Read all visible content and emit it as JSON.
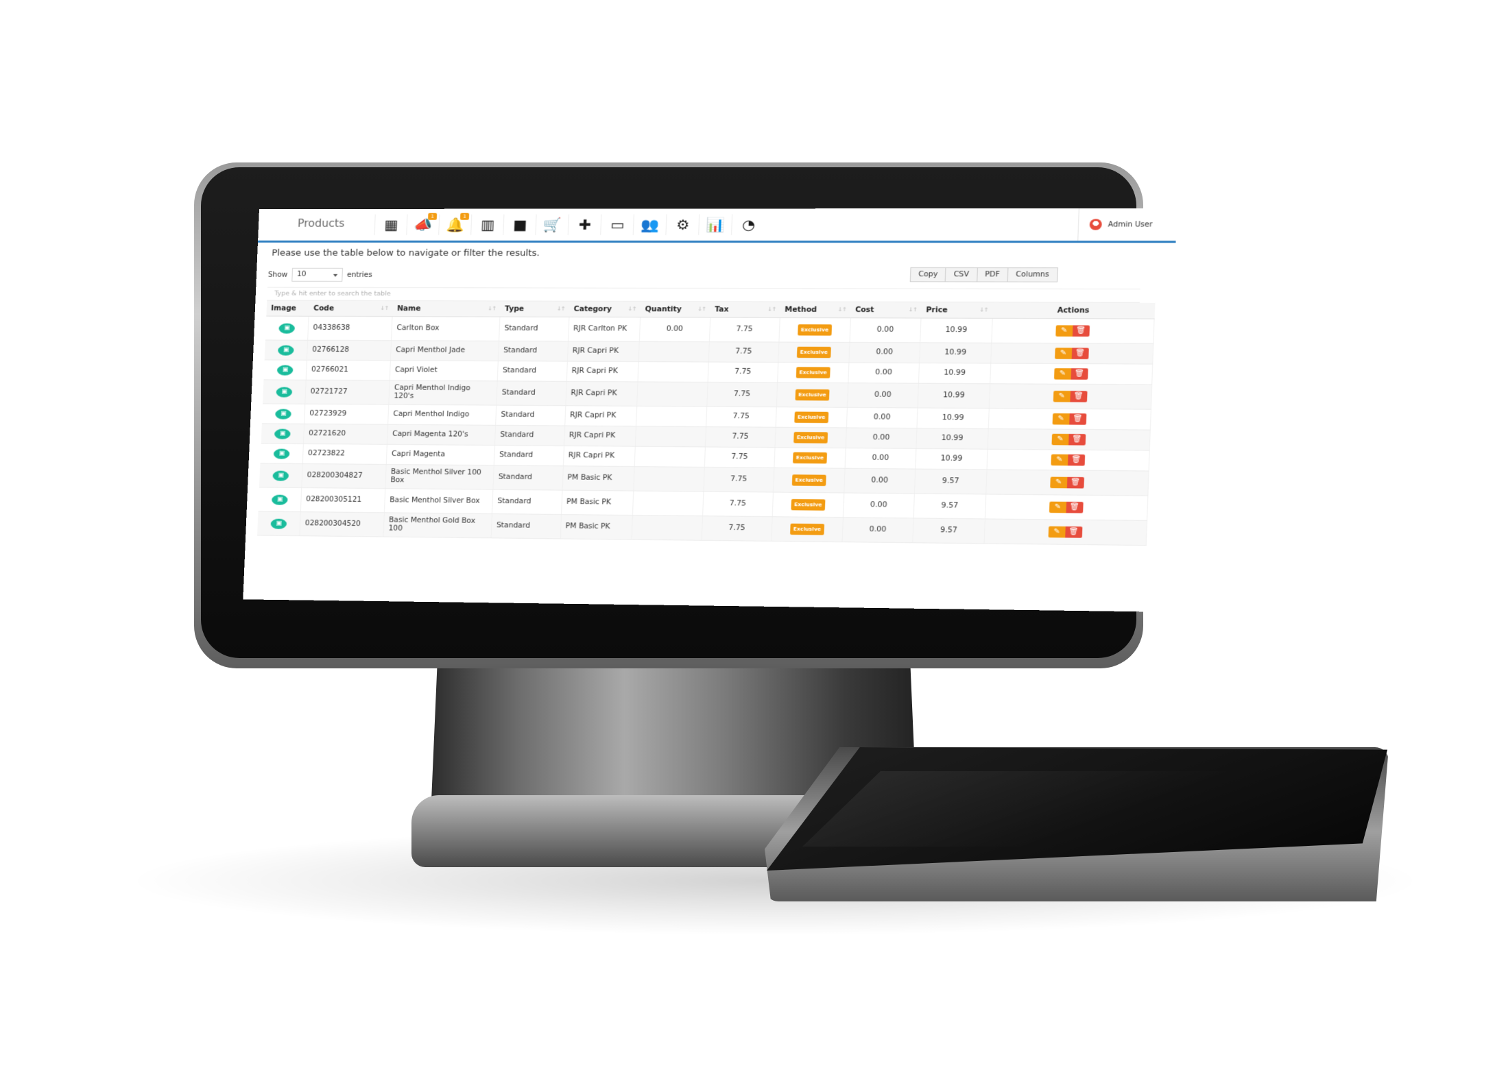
{
  "header": {
    "title": "Products",
    "nav": [
      {
        "name": "apps-grid-icon",
        "glyph": "▦",
        "badge": ""
      },
      {
        "name": "megaphone-icon",
        "glyph": "📣",
        "badge": "1"
      },
      {
        "name": "bell-icon",
        "glyph": "🔔",
        "badge": "1"
      },
      {
        "name": "barcode-icon",
        "glyph": "▥",
        "badge": ""
      },
      {
        "name": "folder-icon",
        "glyph": "■",
        "badge": ""
      },
      {
        "name": "cart-icon",
        "glyph": "🛒",
        "badge": ""
      },
      {
        "name": "plus-icon",
        "glyph": "✚",
        "badge": ""
      },
      {
        "name": "credit-card-icon",
        "glyph": "▭",
        "badge": ""
      },
      {
        "name": "users-icon",
        "glyph": "👥",
        "badge": ""
      },
      {
        "name": "settings-icon",
        "glyph": "⚙",
        "badge": ""
      },
      {
        "name": "bar-chart-icon",
        "glyph": "📊",
        "badge": ""
      },
      {
        "name": "dashboard-icon",
        "glyph": "◔",
        "badge": ""
      }
    ],
    "user": {
      "name": "Admin User"
    }
  },
  "intro": "Please use the table below to navigate or filter the results.",
  "length": {
    "label_before": "Show",
    "value": "10",
    "label_after": "entries"
  },
  "buttons": {
    "copy": "Copy",
    "csv": "CSV",
    "pdf": "PDF",
    "columns": "Columns"
  },
  "search": {
    "placeholder": "Type & hit enter to search the table"
  },
  "columns": [
    "Image",
    "Code",
    "Name",
    "Type",
    "Category",
    "Quantity",
    "Tax",
    "Method",
    "Cost",
    "Price",
    "Actions"
  ],
  "rows": [
    {
      "code": "04338638",
      "name": "Carlton Box",
      "type": "Standard",
      "category": "RJR Carlton PK",
      "quantity": "0.00",
      "tax": "7.75",
      "method": "Exclusive",
      "cost": "0.00",
      "price": "10.99"
    },
    {
      "code": "02766128",
      "name": "Capri Menthol Jade",
      "type": "Standard",
      "category": "RJR Capri PK",
      "quantity": "",
      "tax": "7.75",
      "method": "Exclusive",
      "cost": "0.00",
      "price": "10.99"
    },
    {
      "code": "02766021",
      "name": "Capri Violet",
      "type": "Standard",
      "category": "RJR Capri PK",
      "quantity": "",
      "tax": "7.75",
      "method": "Exclusive",
      "cost": "0.00",
      "price": "10.99"
    },
    {
      "code": "02721727",
      "name": "Capri Menthol Indigo 120's",
      "type": "Standard",
      "category": "RJR Capri PK",
      "quantity": "",
      "tax": "7.75",
      "method": "Exclusive",
      "cost": "0.00",
      "price": "10.99"
    },
    {
      "code": "02723929",
      "name": "Capri Menthol Indigo",
      "type": "Standard",
      "category": "RJR Capri PK",
      "quantity": "",
      "tax": "7.75",
      "method": "Exclusive",
      "cost": "0.00",
      "price": "10.99"
    },
    {
      "code": "02721620",
      "name": "Capri Magenta 120's",
      "type": "Standard",
      "category": "RJR Capri PK",
      "quantity": "",
      "tax": "7.75",
      "method": "Exclusive",
      "cost": "0.00",
      "price": "10.99"
    },
    {
      "code": "02723822",
      "name": "Capri Magenta",
      "type": "Standard",
      "category": "RJR Capri PK",
      "quantity": "",
      "tax": "7.75",
      "method": "Exclusive",
      "cost": "0.00",
      "price": "10.99"
    },
    {
      "code": "028200304827",
      "name": "Basic Menthol Silver 100 Box",
      "type": "Standard",
      "category": "PM Basic PK",
      "quantity": "",
      "tax": "7.75",
      "method": "Exclusive",
      "cost": "0.00",
      "price": "9.57"
    },
    {
      "code": "028200305121",
      "name": "Basic Menthol Silver Box",
      "type": "Standard",
      "category": "PM Basic PK",
      "quantity": "",
      "tax": "7.75",
      "method": "Exclusive",
      "cost": "0.00",
      "price": "9.57"
    },
    {
      "code": "028200304520",
      "name": "Basic Menthol Gold Box 100",
      "type": "Standard",
      "category": "PM Basic PK",
      "quantity": "",
      "tax": "7.75",
      "method": "Exclusive",
      "cost": "0.00",
      "price": "9.57"
    }
  ],
  "icons": {
    "image": "camera-icon",
    "edit": "edit-icon",
    "delete": "trash-icon",
    "sort": "sort-icon"
  },
  "colors": {
    "accent": "#2f7fc1",
    "image_badge": "#1abc9c",
    "method_badge": "#f39c12",
    "edit_button": "#f39c12",
    "delete_button": "#e74c3c"
  }
}
